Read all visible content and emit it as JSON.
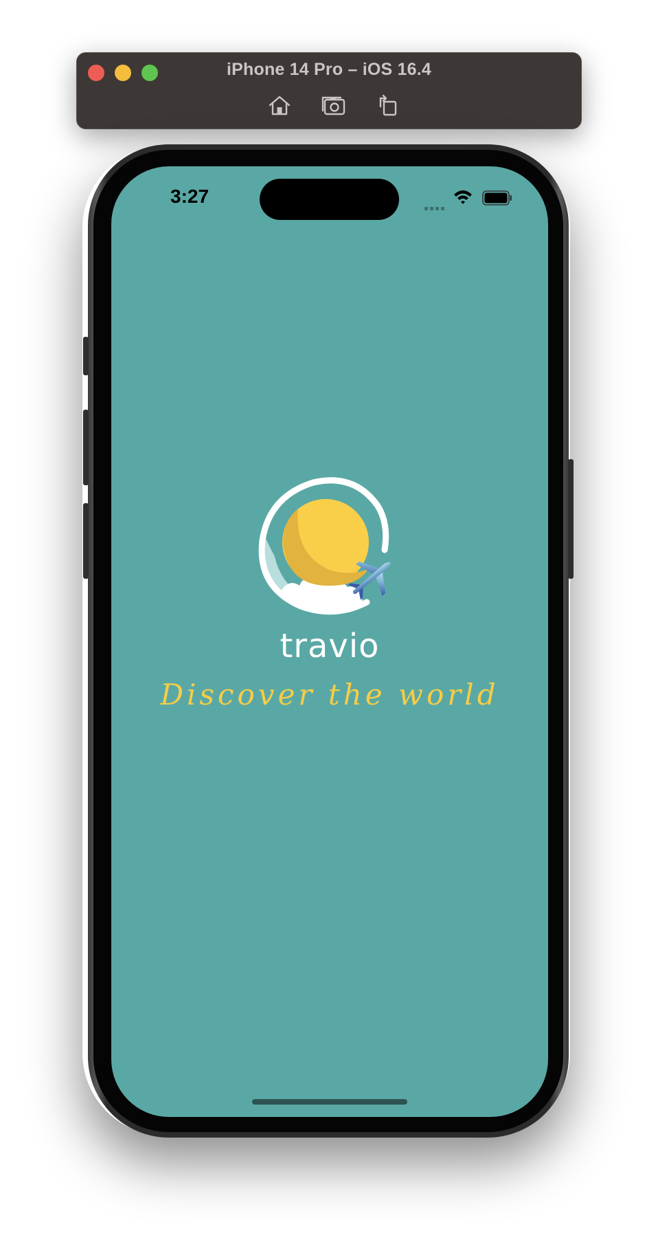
{
  "simulator": {
    "title": "iPhone 14 Pro – iOS 16.4",
    "tools": [
      "home-icon",
      "screenshot-icon",
      "rotate-icon"
    ]
  },
  "status_bar": {
    "time": "3:27"
  },
  "splash": {
    "app_name": "travio",
    "tagline": "Discover the world",
    "logo": "sun-with-airplane-logo"
  },
  "colors": {
    "screen_background": "#5aa8a5",
    "tagline": "#f7cd45",
    "sun": "#f9cf4a",
    "simulator_bar": "#3d3836"
  }
}
